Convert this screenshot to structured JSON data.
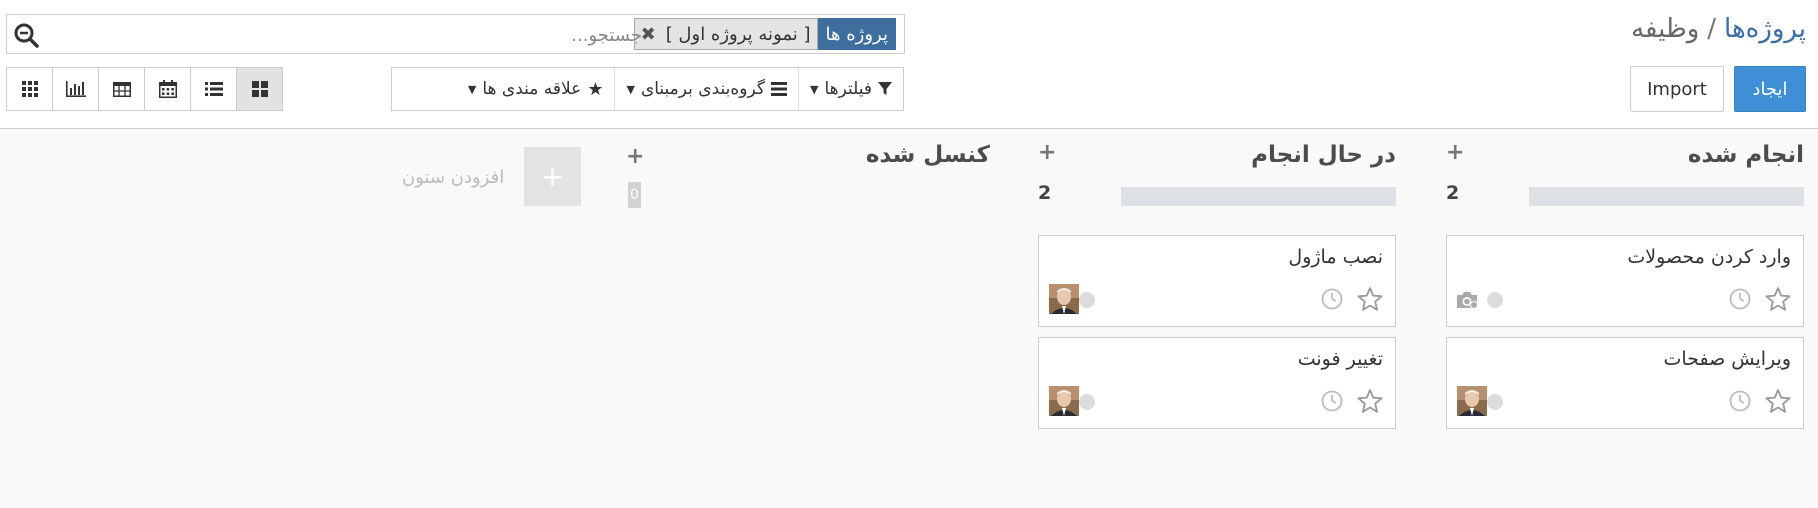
{
  "breadcrumb": {
    "parent": "پروژه‌ها",
    "separator": "/",
    "current": "وظیفه"
  },
  "buttons": {
    "create": "ایجاد",
    "import": "Import"
  },
  "search": {
    "facet_category": "پروژه ها",
    "facet_value": "[ نمونه پروژه اول ]",
    "placeholder": "جستجو..."
  },
  "search_options": {
    "filters": "فیلترها",
    "group_by": "گروه‌بندی برمبنای",
    "favorites": "علاقه مندی ها"
  },
  "view_switcher": [
    "kanban",
    "list",
    "calendar",
    "pivot",
    "graph",
    "activity"
  ],
  "kanban": {
    "columns": [
      {
        "title": "انجام شده",
        "count": "2",
        "cards": [
          {
            "title": "وارد کردن محصولات"
          },
          {
            "title": "ویرایش صفحات"
          }
        ]
      },
      {
        "title": "در حال انجام",
        "count": "2",
        "cards": [
          {
            "title": "نصب ماژول"
          },
          {
            "title": "تغییر فونت"
          }
        ]
      },
      {
        "title": "کنسل شده",
        "count": "0",
        "cards": []
      }
    ],
    "add_column_label": "افزودن ستون"
  }
}
